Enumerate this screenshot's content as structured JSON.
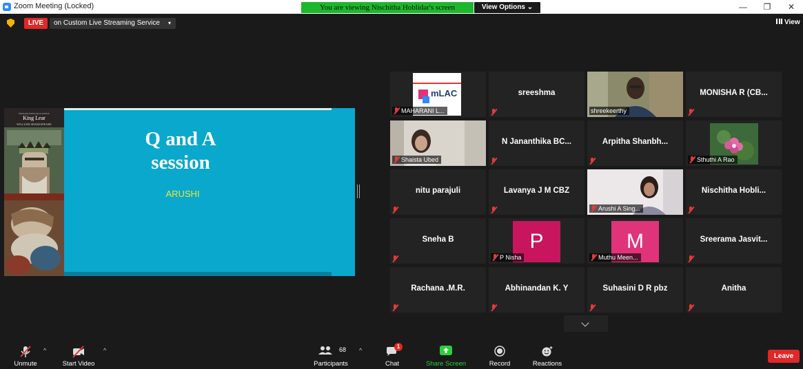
{
  "window": {
    "title": "Zoom Meeting (Locked)",
    "viewing_banner": "You are viewing Nischitha Hoblidar's screen",
    "view_options_label": "View Options ⌄",
    "minimize_glyph": "—",
    "maximize_glyph": "❐",
    "close_glyph": "✕"
  },
  "top_bar": {
    "live_label": "LIVE",
    "stream_label": "on Custom Live Streaming Service",
    "stream_caret": "▾",
    "view_label": "View"
  },
  "shared_content": {
    "book_series": "PENGUIN POPULAR CLASSICS",
    "book_title": "King Lear",
    "book_author": "WILLIAM SHAKESPEARE",
    "slide_title_line1": "Q and A",
    "slide_title_line2": "session",
    "slide_name": "ARUSHI"
  },
  "participants": [
    {
      "label": "MAHARANI L...",
      "type": "logo",
      "logo_text": "mLAC",
      "muted": true
    },
    {
      "label": "sreeshma",
      "type": "name",
      "muted": true
    },
    {
      "label": "shreekeerthy",
      "type": "video",
      "muted": false,
      "active_speaker": true
    },
    {
      "label": "MONISHA R (CB...",
      "type": "name",
      "muted": true
    },
    {
      "label": "Shaista Ubed",
      "type": "video",
      "muted": true
    },
    {
      "label": "N Jananthika BC...",
      "type": "name",
      "muted": true
    },
    {
      "label": "Arpitha Shanbh...",
      "type": "name",
      "muted": true
    },
    {
      "label": "Sthuthi A Rao",
      "type": "photo",
      "muted": true
    },
    {
      "label": "nitu parajuli",
      "type": "name",
      "muted": true
    },
    {
      "label": "Lavanya J M CBZ",
      "type": "name",
      "muted": true
    },
    {
      "label": "Arushi A Sing...",
      "type": "video",
      "muted": true
    },
    {
      "label": "Nischitha Hobli...",
      "type": "name",
      "muted": true
    },
    {
      "label": "Sneha B",
      "type": "name",
      "muted": true
    },
    {
      "label": "P Nisha",
      "type": "initial",
      "initial": "P",
      "color": "#c8155e",
      "muted": true
    },
    {
      "label": "Muthu Meen...",
      "type": "initial",
      "initial": "M",
      "color": "#e0347a",
      "muted": true
    },
    {
      "label": "Sreerama Jasvit...",
      "type": "name",
      "muted": true
    },
    {
      "label": "Rachana .M.R.",
      "type": "name",
      "muted": true
    },
    {
      "label": "Abhinandan K. Y",
      "type": "name",
      "muted": true
    },
    {
      "label": "Suhasini D R  pbz",
      "type": "name",
      "muted": true
    },
    {
      "label": "Anitha",
      "type": "name",
      "muted": true
    }
  ],
  "toolbar": {
    "unmute_label": "Unmute",
    "start_video_label": "Start Video",
    "participants_label": "Participants",
    "participants_count": "68",
    "chat_label": "Chat",
    "chat_badge": "1",
    "share_screen_label": "Share Screen",
    "record_label": "Record",
    "reactions_label": "Reactions",
    "leave_label": "Leave",
    "caret": "^"
  },
  "colors": {
    "accent_green": "#2ecc40",
    "live_red": "#e02828",
    "slide_blue": "#0aa8cd",
    "active_speaker_border": "#d6e86a"
  }
}
